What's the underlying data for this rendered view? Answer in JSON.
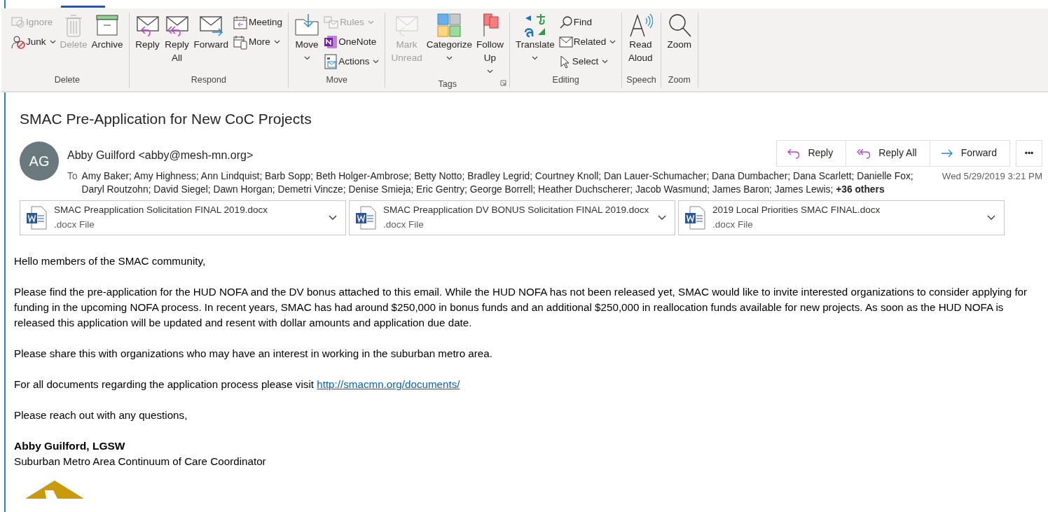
{
  "ribbon": {
    "groups": [
      {
        "label": "Delete",
        "launcher": false,
        "commands": [
          {
            "label": "Ignore",
            "kind": "small",
            "disabled": true,
            "dropdown": false
          },
          {
            "label": "Junk",
            "kind": "small",
            "disabled": false,
            "dropdown": true
          },
          {
            "label": "Delete",
            "kind": "large",
            "disabled": true,
            "dropdown": false
          },
          {
            "label": "Archive",
            "kind": "large",
            "disabled": false,
            "dropdown": false
          }
        ]
      },
      {
        "label": "Respond",
        "launcher": false,
        "commands": [
          {
            "label": "Reply",
            "kind": "large",
            "disabled": false,
            "dropdown": false
          },
          {
            "label": "Reply All",
            "kind": "large",
            "disabled": false,
            "dropdown": false
          },
          {
            "label": "Forward",
            "kind": "large",
            "disabled": false,
            "dropdown": false
          },
          {
            "label": "Meeting",
            "kind": "small",
            "disabled": false,
            "dropdown": false
          },
          {
            "label": "More",
            "kind": "small",
            "disabled": false,
            "dropdown": true
          }
        ]
      },
      {
        "label": "Move",
        "launcher": false,
        "commands": [
          {
            "label": "Move",
            "kind": "large",
            "disabled": false,
            "dropdown": true
          },
          {
            "label": "Rules",
            "kind": "small",
            "disabled": true,
            "dropdown": true
          },
          {
            "label": "OneNote",
            "kind": "small",
            "disabled": false,
            "dropdown": false
          },
          {
            "label": "Actions",
            "kind": "small",
            "disabled": false,
            "dropdown": true
          }
        ]
      },
      {
        "label": "Tags",
        "launcher": true,
        "commands": [
          {
            "label": "Mark Unread",
            "kind": "large",
            "disabled": true,
            "dropdown": false
          },
          {
            "label": "Categorize",
            "kind": "large",
            "disabled": false,
            "dropdown": true
          },
          {
            "label": "Follow Up",
            "kind": "large",
            "disabled": false,
            "dropdown": true
          }
        ]
      },
      {
        "label": "Editing",
        "launcher": false,
        "commands": [
          {
            "label": "Translate",
            "kind": "large",
            "disabled": false,
            "dropdown": true
          },
          {
            "label": "Find",
            "kind": "small",
            "disabled": false,
            "dropdown": false
          },
          {
            "label": "Related",
            "kind": "small",
            "disabled": false,
            "dropdown": true
          },
          {
            "label": "Select",
            "kind": "small",
            "disabled": false,
            "dropdown": true
          }
        ]
      },
      {
        "label": "Speech",
        "launcher": false,
        "commands": [
          {
            "label": "Read Aloud",
            "kind": "large",
            "disabled": false,
            "dropdown": false
          }
        ]
      },
      {
        "label": "Zoom",
        "launcher": false,
        "commands": [
          {
            "label": "Zoom",
            "kind": "large",
            "disabled": false,
            "dropdown": false
          }
        ]
      }
    ]
  },
  "message": {
    "subject": "SMAC Pre-Application for New CoC Projects",
    "avatar": "AG",
    "sender": "Abby Guilford <abby@mesh-mn.org>",
    "to_label": "To",
    "recipients": "Amy Baker; Amy Highness; Ann Lindquist; Barb Sopp; Beth Holger-Ambrose; Betty Notto; Bradley Legrid; Courtney Knoll; Dan Lauer-Schumacher; Dana Dumbacher; Dana Scarlett; Danielle Fox; Daryl Routzohn; David Siegel; Dawn Horgan; Demetri Vincze; Denise Smieja; Eric Gentry; George Borrell; Heather Duchscherer; Jacob Wasmund; James Baron; James Lewis; **+36 others**",
    "date": "Wed 5/29/2019 3:21 PM",
    "actions": [
      "Reply",
      "Reply All",
      "Forward"
    ],
    "more": "•••",
    "attachments": [
      {
        "name": "SMAC Preapplication Solicitation FINAL 2019.docx",
        "type": ".docx File"
      },
      {
        "name": "SMAC Preapplication DV BONUS Solicitation FINAL 2019.docx",
        "type": ".docx File"
      },
      {
        "name": "2019 Local Priorities SMAC FINAL.docx",
        "type": ".docx File"
      }
    ],
    "body": [
      {
        "text": "Hello members of the SMAC community,"
      },
      {
        "text": "Please find the pre-application for the HUD NOFA and the DV bonus attached to this email.  While the HUD NOFA has not been released yet, SMAC would like to invite interested organizations to consider applying for funding in the upcoming NOFA process.  In recent years, SMAC has had around $250,000 in bonus funds and an additional $250,000 in reallocation funds available for new projects.  As soon as the HUD NOFA is released this application will be updated and resent with dollar amounts and application due date."
      },
      {
        "text": "Please share this with organizations who may have an interest in working in the suburban metro area."
      },
      {
        "text": "For all documents regarding the application process please visit ",
        "link": "http://smacmn.org/documents/"
      },
      {
        "text": "Please reach out with any questions,"
      }
    ],
    "signature": {
      "name": "Abby Guilford, LGSW",
      "title": "Suburban Metro Area Continuum of Care Coordinator"
    }
  }
}
